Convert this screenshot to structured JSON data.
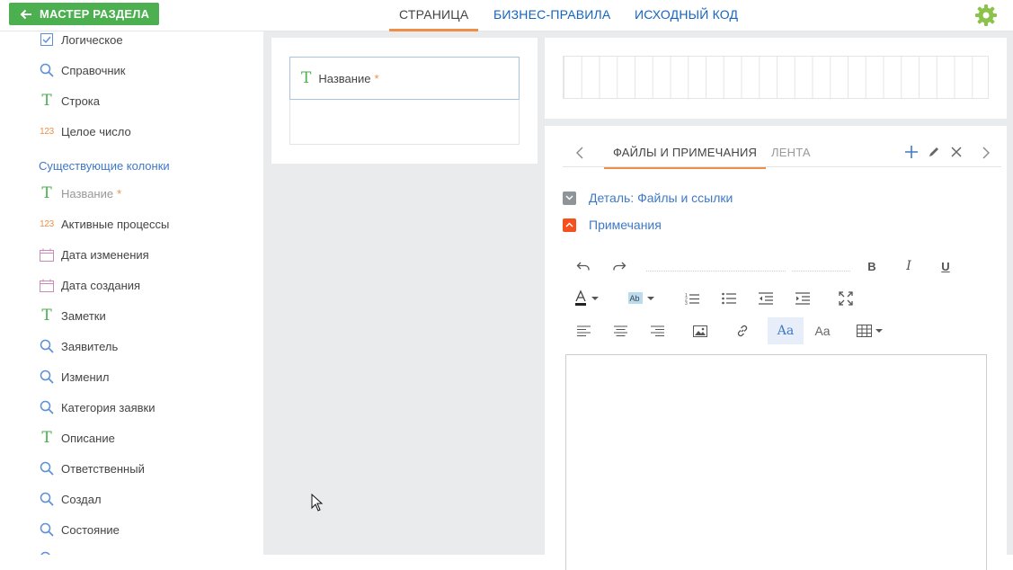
{
  "topbar": {
    "back_label": "МАСТЕР РАЗДЕЛА",
    "tabs": [
      {
        "label": "СТРАНИЦА",
        "active": true
      },
      {
        "label": "БИЗНЕС-ПРАВИЛА",
        "active": false
      },
      {
        "label": "ИСХОДНЫЙ КОД",
        "active": false
      }
    ],
    "accent": "#4caf50",
    "active_tab_color": "#ef8f47"
  },
  "sidebar": {
    "new_types": [
      {
        "label": "Логическое",
        "icon": "checkbox-icon"
      },
      {
        "label": "Справочник",
        "icon": "search-icon"
      },
      {
        "label": "Строка",
        "icon": "text-icon"
      },
      {
        "label": "Целое число",
        "icon": "number-icon"
      }
    ],
    "existing_header": "Существующие колонки",
    "existing": [
      {
        "label": "Название",
        "icon": "text-icon",
        "required": "*"
      },
      {
        "label": "Активные процессы",
        "icon": "number-icon"
      },
      {
        "label": "Дата изменения",
        "icon": "calendar-icon"
      },
      {
        "label": "Дата создания",
        "icon": "calendar-icon"
      },
      {
        "label": "Заметки",
        "icon": "text-icon"
      },
      {
        "label": "Заявитель",
        "icon": "search-icon"
      },
      {
        "label": "Изменил",
        "icon": "search-icon"
      },
      {
        "label": "Категория заявки",
        "icon": "search-icon"
      },
      {
        "label": "Описание",
        "icon": "text-icon"
      },
      {
        "label": "Ответственный",
        "icon": "search-icon"
      },
      {
        "label": "Создал",
        "icon": "search-icon"
      },
      {
        "label": "Состояние",
        "icon": "search-icon"
      }
    ]
  },
  "canvas": {
    "field": {
      "label": "Название",
      "required": "*"
    },
    "detail_tabs": {
      "files_label": "ФАЙЛЫ И ПРИМЕЧАНИЯ",
      "feed_label": "ЛЕНТА"
    },
    "detail_files": "Деталь: Файлы и ссылки",
    "notes": "Примечания",
    "editor": {
      "bold": "B",
      "italic": "I",
      "underline": "U",
      "font_size_a": "Aa",
      "font_size_b": "Aa"
    }
  }
}
